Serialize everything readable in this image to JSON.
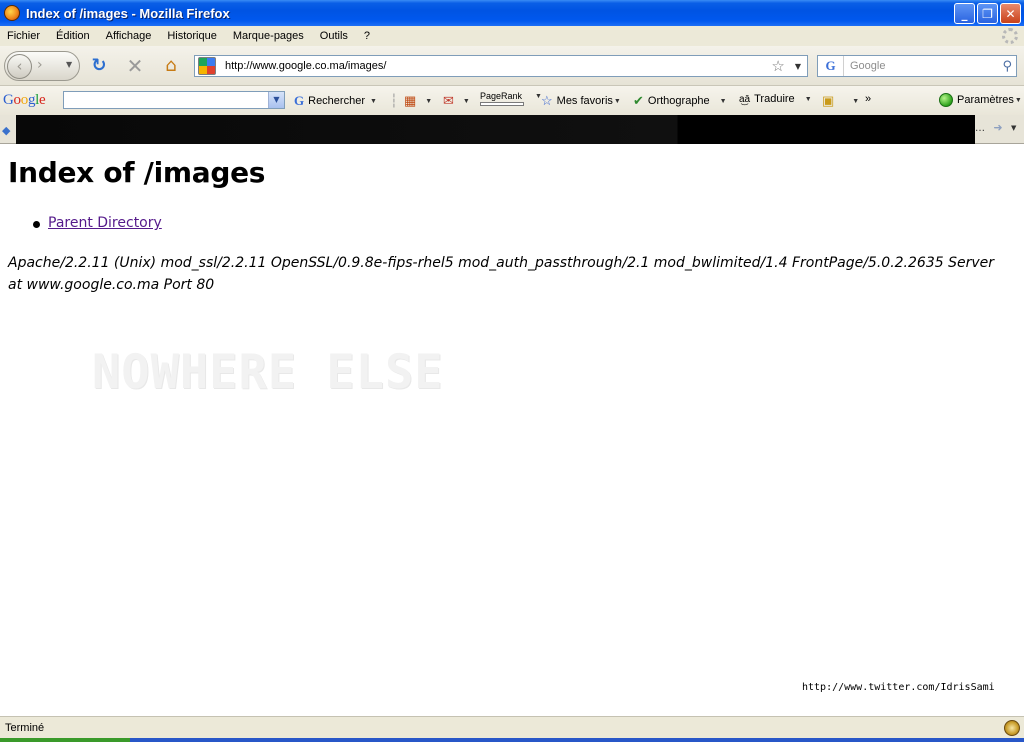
{
  "window": {
    "title": "Index of /images - Mozilla Firefox",
    "minimize": "_",
    "maximize": "❐",
    "close": "✕"
  },
  "menu": [
    "Fichier",
    "Édition",
    "Affichage",
    "Historique",
    "Marque-pages",
    "Outils",
    "?"
  ],
  "nav": {
    "url": "http://www.google.co.ma/images/",
    "search_placeholder": "Google",
    "search_engine_icon": "G"
  },
  "google_toolbar": {
    "rechercher": "Rechercher",
    "pagerank": "PageRank",
    "mes_favoris": "Mes favoris",
    "orthographe": "Orthographe",
    "traduire": "Traduire",
    "more": "»",
    "parametres": "Paramètres"
  },
  "page": {
    "heading": "Index of /images",
    "parent_link": "Parent Directory",
    "server_line": "Apache/2.2.11 (Unix) mod_ssl/2.2.11 OpenSSL/0.9.8e-fips-rhel5 mod_auth_passthrough/2.1 mod_bwlimited/1.4 FrontPage/5.0.2.2635 Server at www.google.co.ma Port 80",
    "watermark": "NOWHERE ELSE",
    "twitter": "http://www.twitter.com/IdrisSami"
  },
  "status": {
    "text": "Terminé"
  }
}
